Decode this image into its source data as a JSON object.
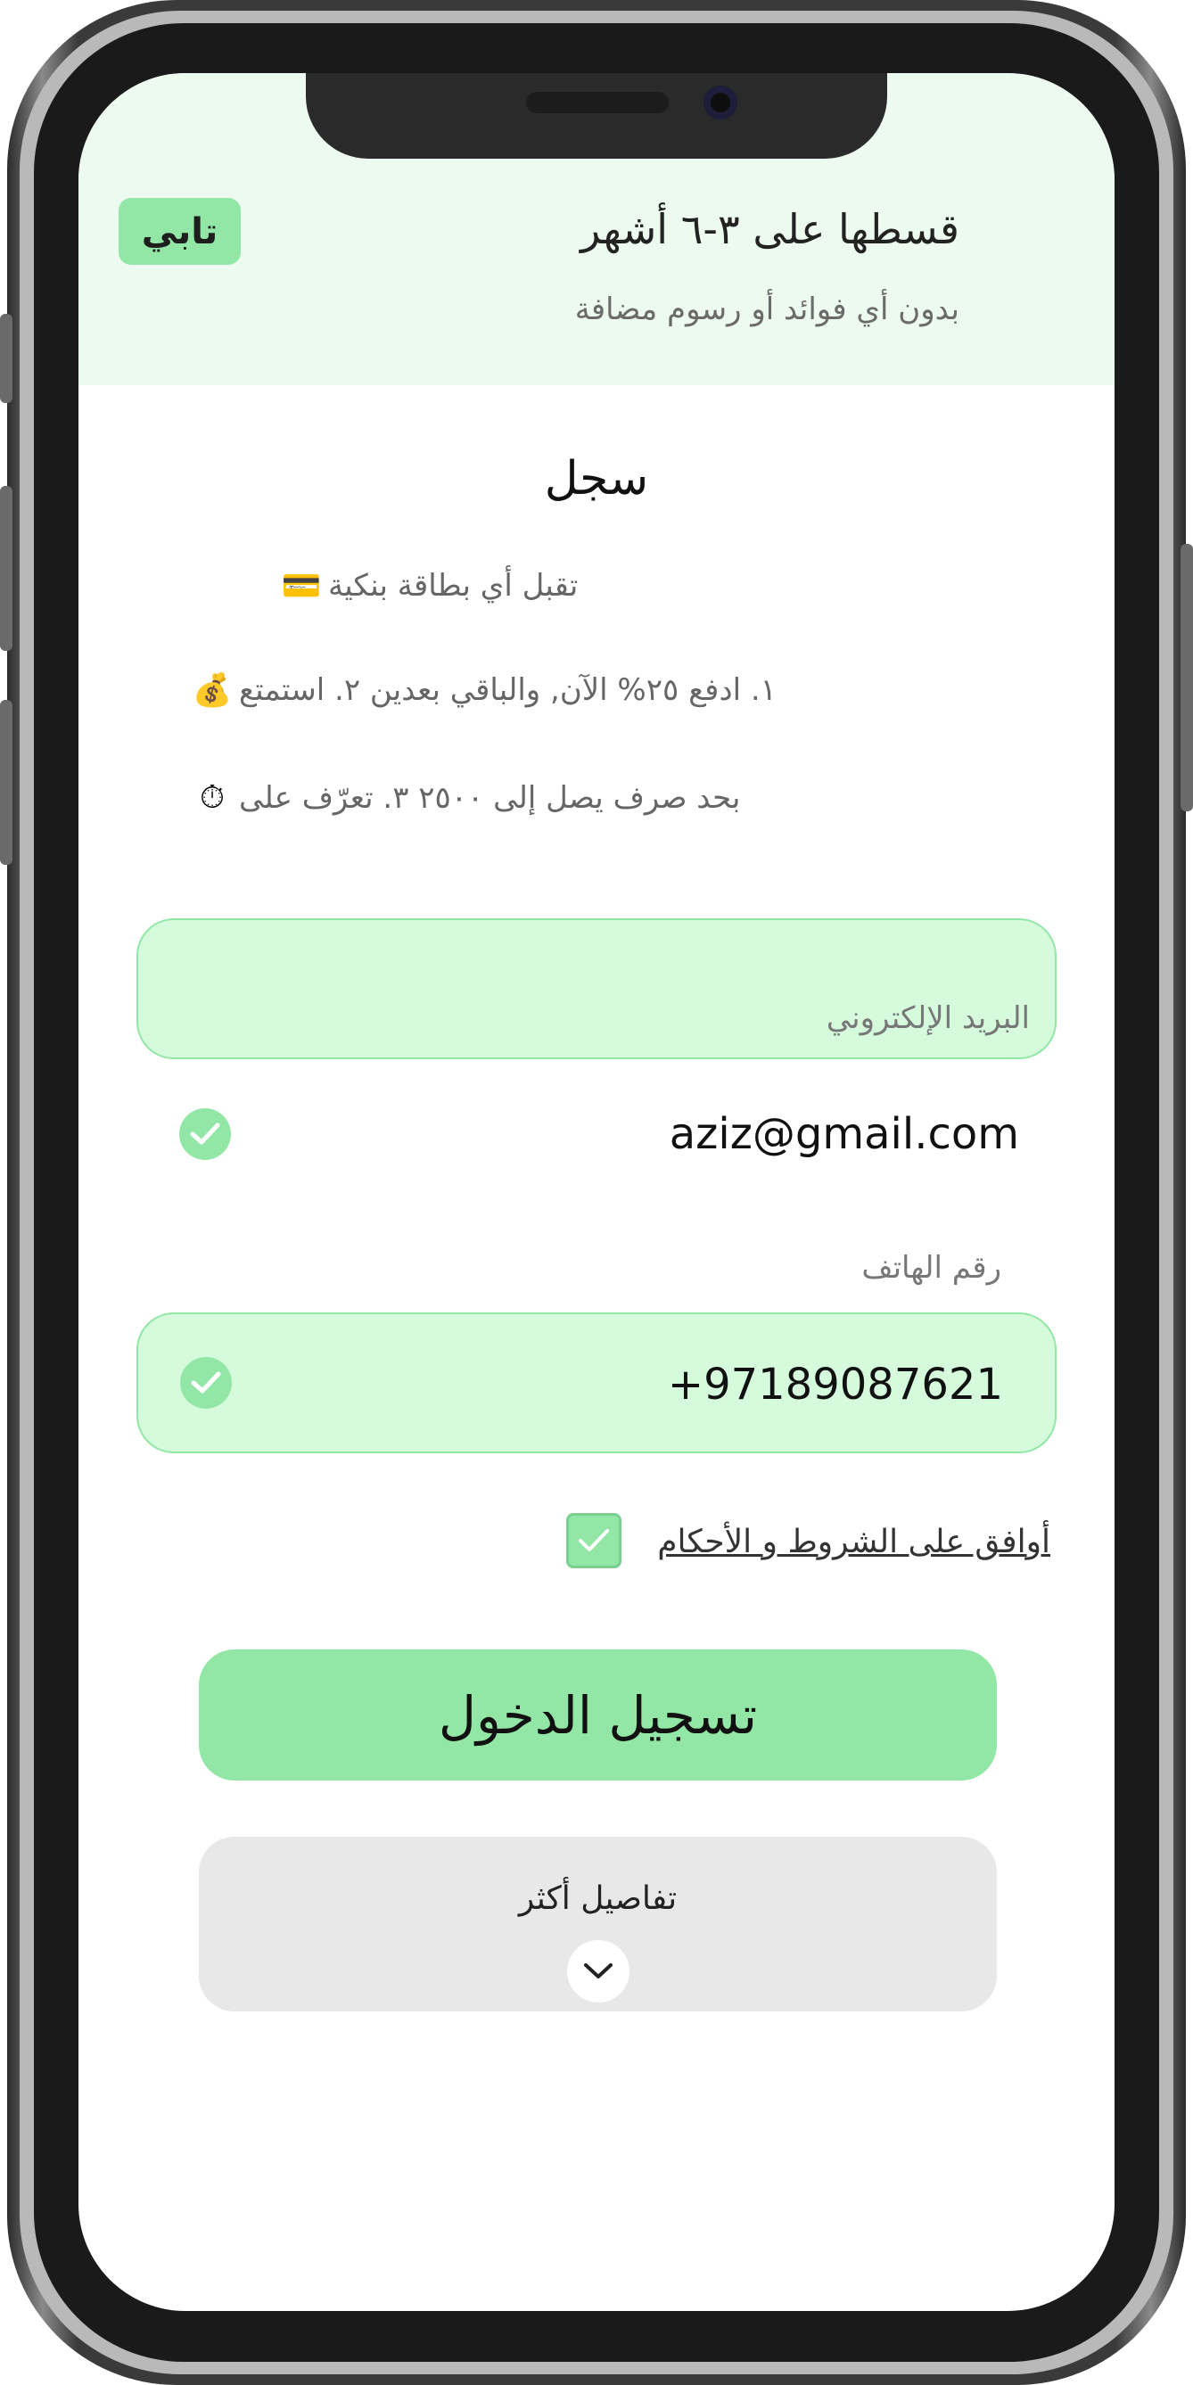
{
  "header": {
    "logo_text": "تابي",
    "title": "قسطها على ٣-٦ أشهر",
    "subtitle": "بدون أي فوائد أو رسوم مضافة"
  },
  "section_title": "سجل",
  "features": [
    {
      "icon": "credit-card-icon",
      "glyph": "💳",
      "text": "تقبل أي بطاقة بنكية"
    },
    {
      "icon": "money-bag-icon",
      "glyph": "💰",
      "text": "١. ادفع ٢٥% الآن, والباقي بعدين ٢. استمتع"
    },
    {
      "icon": "stopwatch-icon",
      "glyph": "⏱",
      "text": "بحد صرف يصل إلى ٢٥٠٠ ٣. تعرّف على"
    }
  ],
  "form": {
    "email_label": "البريد الإلكتروني",
    "email_value": "aziz@gmail.com",
    "phone_label": "رقم الهاتف",
    "phone_value": "+97189087621",
    "terms_label": "أوافق على الشروط و الأحكام",
    "login_button": "تسجيل الدخول",
    "more_details": "تفاصيل أكثر"
  },
  "colors": {
    "accent": "#93e7a6",
    "header_bg": "#edfaef",
    "field_bg": "#d5fbdc",
    "panel_bg": "#e8e8e8"
  }
}
